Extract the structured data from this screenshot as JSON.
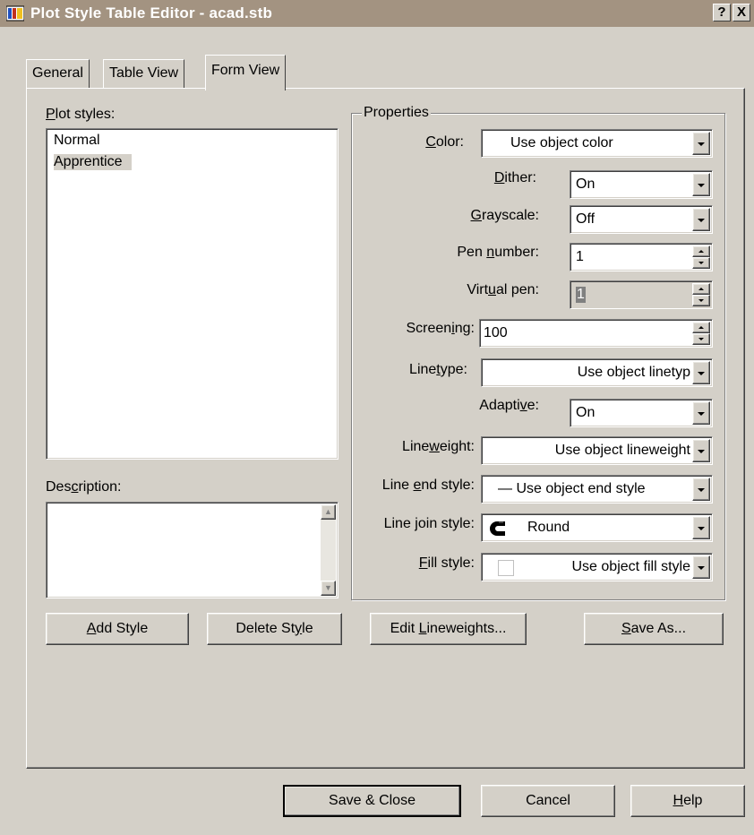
{
  "window": {
    "title": "Plot Style Table Editor - acad.stb",
    "help_glyph": "?",
    "close_glyph": "X"
  },
  "tabs": [
    {
      "label": "General"
    },
    {
      "label": "Table View"
    },
    {
      "label": "Form View"
    }
  ],
  "plot_styles": {
    "label_pre": "",
    "label_mn": "P",
    "label_post": "lot styles:",
    "items": [
      "Normal",
      "Apprentice"
    ]
  },
  "description": {
    "label_pre": "Des",
    "label_mn": "c",
    "label_post": "ription:",
    "value": ""
  },
  "properties": {
    "legend": "Properties",
    "color": {
      "label_pre": "",
      "label_mn": "C",
      "label_post": "olor:",
      "value": "Use object color"
    },
    "dither": {
      "label_pre": "",
      "label_mn": "D",
      "label_post": "ither:",
      "value": "On"
    },
    "grayscale": {
      "label_pre": "",
      "label_mn": "G",
      "label_post": "rayscale:",
      "value": "Off"
    },
    "pen_number": {
      "label_pre": "Pen ",
      "label_mn": "n",
      "label_post": "umber:",
      "value": "1"
    },
    "virtual_pen": {
      "label_pre": "Virt",
      "label_mn": "u",
      "label_post": "al pen:",
      "value": "1"
    },
    "screening": {
      "label_pre": "Screen",
      "label_mn": "i",
      "label_post": "ng:",
      "value": "100"
    },
    "linetype": {
      "label_pre": "Line",
      "label_mn": "t",
      "label_post": "ype:",
      "value": "Use object linetyp"
    },
    "adaptive": {
      "label_pre": "Adapti",
      "label_mn": "v",
      "label_post": "e:",
      "value": "On"
    },
    "lineweight": {
      "label_pre": "Line",
      "label_mn": "w",
      "label_post": "eight:",
      "value": "Use object lineweight"
    },
    "line_end_style": {
      "label_pre": "Line ",
      "label_mn": "e",
      "label_post": "nd style:",
      "value": "— Use object end style"
    },
    "line_join_style": {
      "label_pre": "Line ",
      "label_mn": "j",
      "label_post": "oin style:",
      "value": "Round"
    },
    "fill_style": {
      "label_pre": "",
      "label_mn": "F",
      "label_post": "ill style:",
      "value": "Use object fill style"
    }
  },
  "buttons": {
    "add_style": {
      "pre": "",
      "mn": "A",
      "post": "dd Style"
    },
    "delete_style": {
      "pre": "Delete St",
      "mn": "y",
      "post": "le"
    },
    "edit_lineweights": {
      "pre": "Edit ",
      "mn": "L",
      "post": "ineweights..."
    },
    "save_as": {
      "pre": "",
      "mn": "S",
      "post": "ave As..."
    },
    "save_close": "Save & Close",
    "cancel": "Cancel",
    "help": {
      "pre": "",
      "mn": "H",
      "post": "elp"
    }
  },
  "icons": {
    "app": "plot-style-icon",
    "join": "round-join-icon",
    "fill": "fill-swatch-icon"
  },
  "colors": {
    "titlebar": "#a39381",
    "face": "#d4d0c8"
  }
}
